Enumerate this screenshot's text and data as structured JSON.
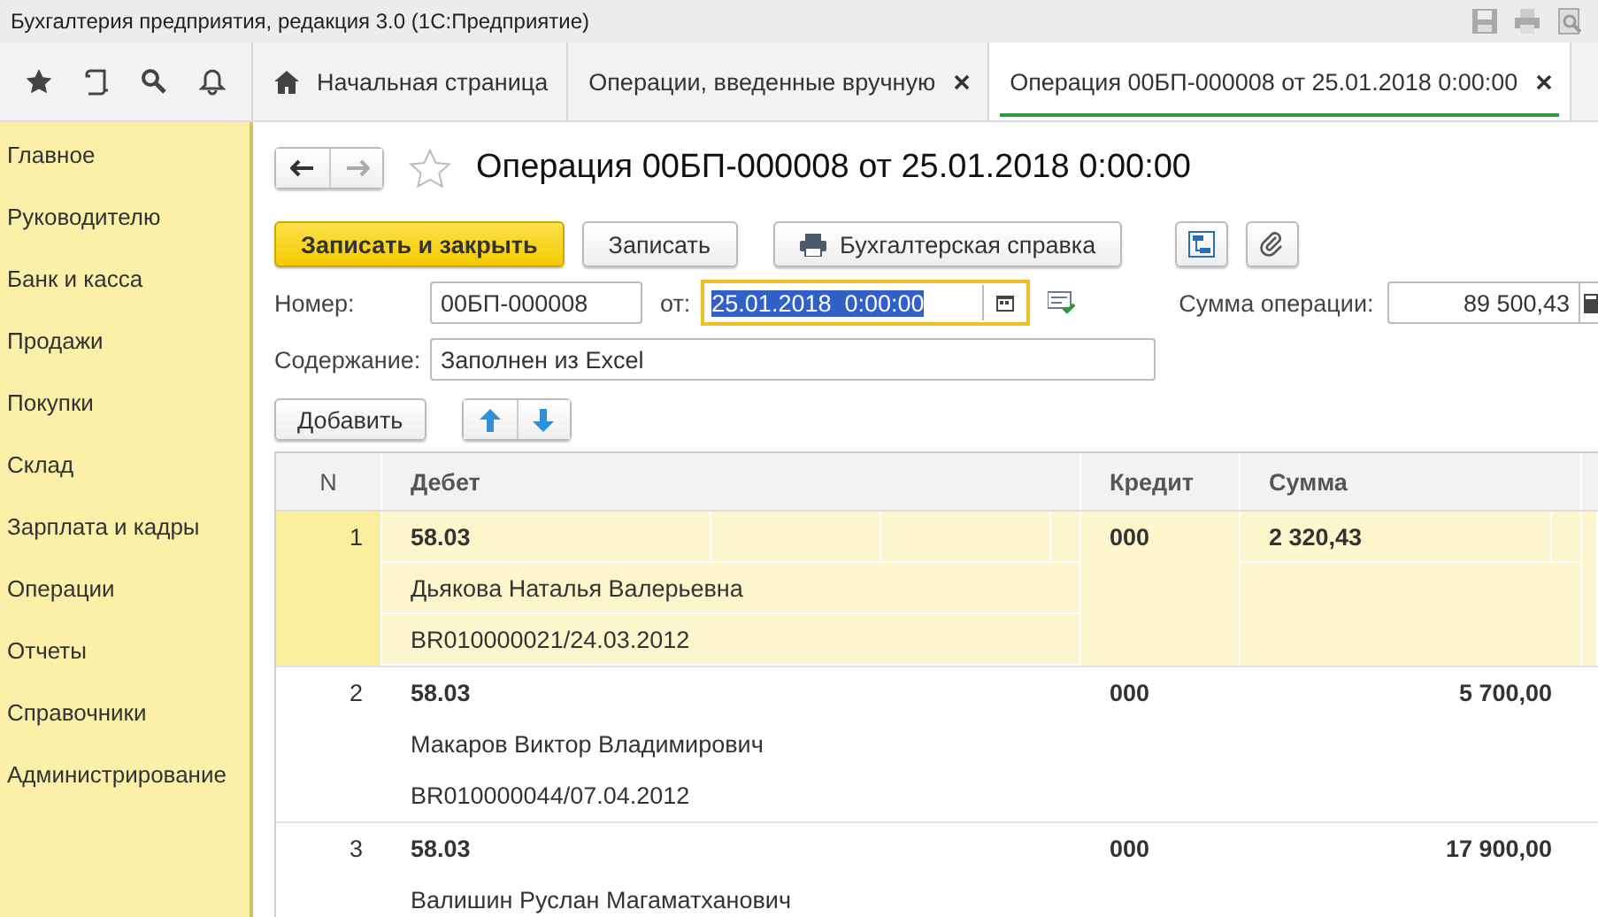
{
  "window": {
    "title": "Бухгалтерия предприятия, редакция 3.0  (1С:Предприятие)"
  },
  "tabs": [
    {
      "label": "Начальная страница",
      "kind": "home",
      "selected": false
    },
    {
      "label": "Операции, введенные вручную",
      "kind": "document",
      "selected": false
    },
    {
      "label": "Операция 00БП-000008 от 25.01.2018 0:00:00",
      "kind": "document",
      "selected": true
    }
  ],
  "sidebar": {
    "items": [
      "Главное",
      "Руководителю",
      "Банк и касса",
      "Продажи",
      "Покупки",
      "Склад",
      "Зарплата и кадры",
      "Операции",
      "Отчеты",
      "Справочники",
      "Администрирование"
    ]
  },
  "form": {
    "title": "Операция 00БП-000008 от 25.01.2018 0:00:00",
    "buttons": {
      "save_close": "Записать и закрыть",
      "save": "Записать",
      "report": "Бухгалтерская справка"
    },
    "number_label": "Номер:",
    "number": "00БП-000008",
    "date_label": "от:",
    "date": "25.01.2018  0:00:00",
    "sum_label": "Сумма операции:",
    "sum": "89 500,43",
    "content_label": "Содержание:",
    "content": "Заполнен из Excel",
    "add_button": "Добавить"
  },
  "table": {
    "columns": [
      "N",
      "Дебет",
      "Кредит",
      "Сумма"
    ],
    "rows": [
      {
        "n": "1",
        "debit": "58.03",
        "lines": [
          "Дьякова Наталья Валерьевна",
          "BR010000021/24.03.2012"
        ],
        "credit": "000",
        "sum": "2 320,43",
        "selected": true
      },
      {
        "n": "2",
        "debit": "58.03",
        "lines": [
          "Макаров Виктор Владимирович",
          "BR010000044/07.04.2012"
        ],
        "credit": "000",
        "sum": "5 700,00",
        "selected": false
      },
      {
        "n": "3",
        "debit": "58.03",
        "lines": [
          "Валишин Руслан Магаматханович"
        ],
        "credit": "000",
        "sum": "17 900,00",
        "selected": false
      }
    ]
  }
}
